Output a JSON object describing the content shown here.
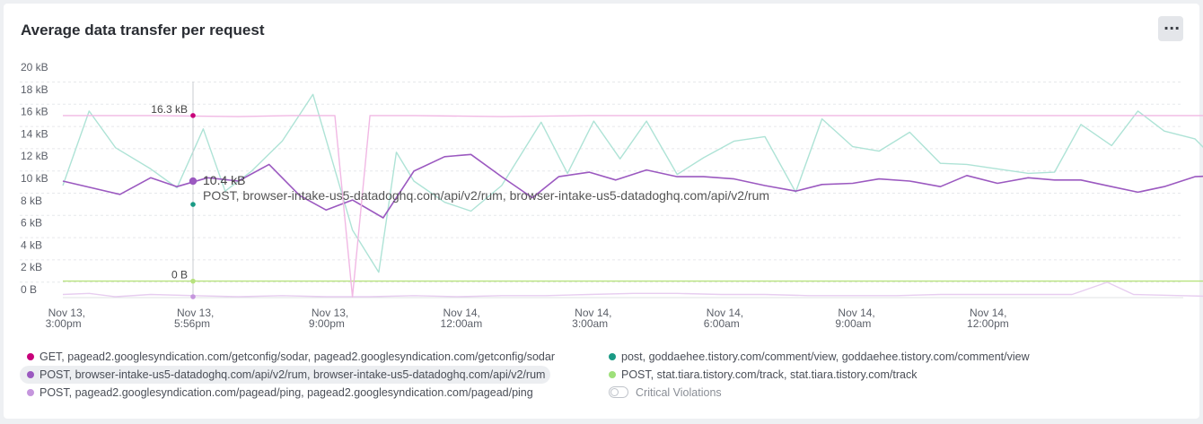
{
  "card": {
    "title": "Average data transfer per request",
    "menu_label": "···"
  },
  "chart_data": {
    "type": "line",
    "ylim": [
      0,
      20
    ],
    "yunit": "kB",
    "y_ticks": [
      "0 B",
      "2 kB",
      "4 kB",
      "6 kB",
      "8 kB",
      "10 kB",
      "12 kB",
      "14 kB",
      "16 kB",
      "18 kB",
      "20 kB"
    ],
    "x_range": [
      "Nov 13 14:58",
      "Nov 14 16:30"
    ],
    "x_ticks": [
      {
        "t": "Nov 13 15:00",
        "line1": "Nov 13,",
        "line2": "3:00pm"
      },
      {
        "t": "Nov 13 17:56",
        "line1": "Nov 13,",
        "line2": "5:56pm"
      },
      {
        "t": "Nov 13 21:00",
        "line1": "Nov 13,",
        "line2": "9:00pm"
      },
      {
        "t": "Nov 14 00:00",
        "line1": "Nov 14,",
        "line2": "12:00am"
      },
      {
        "t": "Nov 14 03:00",
        "line1": "Nov 14,",
        "line2": "3:00am"
      },
      {
        "t": "Nov 14 06:00",
        "line1": "Nov 14,",
        "line2": "6:00am"
      },
      {
        "t": "Nov 14 09:00",
        "line1": "Nov 14,",
        "line2": "9:00am"
      },
      {
        "t": "Nov 14 12:00",
        "line1": "Nov 14,",
        "line2": "12:00pm"
      }
    ],
    "grid": true,
    "series": [
      {
        "name": "GET, pagead2.googlesyndication.com/getconfig/sodar, pagead2.googlesyndication.com/getconfig/sodar",
        "color": "#f1b8e4",
        "values": [
          [
            0.0,
            16.3
          ],
          [
            2.0,
            16.3
          ],
          [
            4.0,
            16.2
          ],
          [
            5.2,
            16.3
          ],
          [
            6.2,
            16.3
          ],
          [
            6.6,
            0
          ],
          [
            7.0,
            16.3
          ],
          [
            8.0,
            16.3
          ],
          [
            10.0,
            16.2
          ],
          [
            12.0,
            16.3
          ],
          [
            16.0,
            16.3
          ],
          [
            20.0,
            16.3
          ],
          [
            24.0,
            16.3
          ],
          [
            26.0,
            16.3
          ]
        ]
      },
      {
        "name": "post, goddaehee.tistory.com/comment/view, goddaehee.tistory.com/comment/view",
        "color": "#aee3d6",
        "values": [
          [
            0.0,
            10.0
          ],
          [
            0.6,
            16.7
          ],
          [
            1.2,
            13.4
          ],
          [
            2.0,
            11.5
          ],
          [
            2.6,
            9.8
          ],
          [
            3.2,
            15.1
          ],
          [
            3.7,
            9.5
          ],
          [
            4.3,
            11.3
          ],
          [
            5.0,
            14.0
          ],
          [
            5.7,
            18.2
          ],
          [
            6.6,
            6.0
          ],
          [
            7.2,
            2.2
          ],
          [
            7.6,
            13.0
          ],
          [
            8.0,
            10.4
          ],
          [
            8.7,
            8.5
          ],
          [
            9.3,
            7.7
          ],
          [
            10.0,
            10.0
          ],
          [
            10.9,
            15.7
          ],
          [
            11.5,
            11.1
          ],
          [
            12.1,
            15.8
          ],
          [
            12.7,
            12.4
          ],
          [
            13.3,
            15.8
          ],
          [
            14.0,
            11.0
          ],
          [
            14.6,
            12.5
          ],
          [
            15.3,
            14.0
          ],
          [
            16.0,
            14.4
          ],
          [
            16.7,
            9.4
          ],
          [
            17.3,
            16.0
          ],
          [
            18.0,
            13.5
          ],
          [
            18.6,
            13.1
          ],
          [
            19.3,
            14.8
          ],
          [
            20.0,
            12.0
          ],
          [
            20.6,
            11.9
          ],
          [
            21.3,
            11.5
          ],
          [
            22.0,
            11.1
          ],
          [
            22.6,
            11.2
          ],
          [
            23.2,
            15.5
          ],
          [
            23.9,
            13.6
          ],
          [
            24.5,
            16.7
          ],
          [
            25.1,
            14.9
          ],
          [
            25.8,
            14.2
          ],
          [
            26.4,
            11.8
          ],
          [
            27.0,
            14.9
          ],
          [
            27.7,
            13.5
          ],
          [
            28.3,
            12.3
          ],
          [
            29.0,
            11.9
          ],
          [
            29.8,
            13.0
          ],
          [
            30.5,
            17.9
          ],
          [
            31.0,
            11.8
          ]
        ]
      },
      {
        "name": "POST, browser-intake-us5-datadoghq.com/api/v2/rum, browser-intake-us5-datadoghq.com/api/v2/rum",
        "color": "#9b59c0",
        "values": [
          [
            0.0,
            10.4
          ],
          [
            1.3,
            9.2
          ],
          [
            2.0,
            10.7
          ],
          [
            2.6,
            9.9
          ],
          [
            3.3,
            10.7
          ],
          [
            4.0,
            10.4
          ],
          [
            4.7,
            11.9
          ],
          [
            5.4,
            9.1
          ],
          [
            6.0,
            7.8
          ],
          [
            6.6,
            8.7
          ],
          [
            7.3,
            7.1
          ],
          [
            8.0,
            11.3
          ],
          [
            8.7,
            12.6
          ],
          [
            9.3,
            12.8
          ],
          [
            10.0,
            10.8
          ],
          [
            10.7,
            8.9
          ],
          [
            11.3,
            10.8
          ],
          [
            12.0,
            11.2
          ],
          [
            12.6,
            10.5
          ],
          [
            13.3,
            11.4
          ],
          [
            14.0,
            10.8
          ],
          [
            14.6,
            10.8
          ],
          [
            15.3,
            10.6
          ],
          [
            16.0,
            10.0
          ],
          [
            16.7,
            9.5
          ],
          [
            17.3,
            10.1
          ],
          [
            18.0,
            10.2
          ],
          [
            18.6,
            10.6
          ],
          [
            19.3,
            10.4
          ],
          [
            20.0,
            9.9
          ],
          [
            20.6,
            10.9
          ],
          [
            21.3,
            10.2
          ],
          [
            22.0,
            10.7
          ],
          [
            22.6,
            10.5
          ],
          [
            23.2,
            10.5
          ],
          [
            23.9,
            9.9
          ],
          [
            24.5,
            9.4
          ],
          [
            25.1,
            9.9
          ],
          [
            25.8,
            10.8
          ],
          [
            26.4,
            10.9
          ],
          [
            27.0,
            10.5
          ],
          [
            27.7,
            9.7
          ],
          [
            28.3,
            10.3
          ],
          [
            29.0,
            10.8
          ],
          [
            29.6,
            11.7
          ],
          [
            30.2,
            11.3
          ],
          [
            30.7,
            11.7
          ],
          [
            31.2,
            10.0
          ]
        ]
      },
      {
        "name": "POST, stat.tiara.tistory.com/track, stat.tiara.tistory.com/track",
        "color": "#b7e27e",
        "values": [
          [
            0.0,
            1.4
          ],
          [
            5.0,
            1.4
          ],
          [
            10.0,
            1.4
          ],
          [
            15.0,
            1.4
          ],
          [
            20.0,
            1.4
          ],
          [
            25.0,
            1.4
          ],
          [
            31.2,
            1.4
          ]
        ]
      },
      {
        "name": "POST, pagead2.googlesyndication.com/pagead/ping, pagead2.googlesyndication.com/pagead/ping",
        "color": "#e7cdf0",
        "values": [
          [
            0.0,
            0.2
          ],
          [
            0.6,
            0.3
          ],
          [
            1.2,
            0.0
          ],
          [
            2.0,
            0.2
          ],
          [
            3.0,
            0.1
          ],
          [
            4.0,
            0.0
          ],
          [
            5.0,
            0.1
          ],
          [
            6.0,
            0.0
          ],
          [
            7.0,
            0.0
          ],
          [
            8.0,
            0.1
          ],
          [
            9.0,
            0.0
          ],
          [
            10.0,
            0.1
          ],
          [
            11.0,
            0.1
          ],
          [
            12.0,
            0.2
          ],
          [
            13.0,
            0.3
          ],
          [
            14.0,
            0.3
          ],
          [
            15.0,
            0.2
          ],
          [
            16.0,
            0.2
          ],
          [
            17.0,
            0.1
          ],
          [
            18.0,
            0.1
          ],
          [
            19.0,
            0.1
          ],
          [
            20.0,
            0.2
          ],
          [
            21.0,
            0.2
          ],
          [
            22.0,
            0.2
          ],
          [
            23.0,
            0.2
          ],
          [
            23.8,
            1.3
          ],
          [
            24.4,
            0.2
          ],
          [
            25.5,
            0.1
          ],
          [
            26.5,
            0.0
          ],
          [
            27.5,
            0.2
          ],
          [
            28.5,
            0.2
          ],
          [
            29.5,
            0.3
          ],
          [
            30.5,
            0.3
          ],
          [
            31.2,
            0.3
          ]
        ]
      }
    ],
    "cursor": {
      "x": "Nov 13 17:56",
      "markers": [
        {
          "label": "16.3 kB",
          "value": 16.3,
          "color": "#c8007a"
        },
        {
          "label": "",
          "value": 10.4,
          "color": "#9b59c0"
        },
        {
          "label": "",
          "value": 8.3,
          "color": "#1a9a85"
        },
        {
          "label": "0 B",
          "value": 1.4,
          "color": "#b7e27e"
        },
        {
          "label": "",
          "value": 0.0,
          "color": "#c596dd"
        }
      ],
      "tooltip_value": "10.4 kB",
      "tooltip_series": "POST, browser-intake-us5-datadoghq.com/api/v2/rum, browser-intake-us5-datadoghq.com/api/v2/rum"
    }
  },
  "legend": {
    "items": [
      {
        "label": "GET, pagead2.googlesyndication.com/getconfig/sodar, pagead2.googlesyndication.com/getconfig/sodar",
        "color": "#c8007a"
      },
      {
        "label": "POST, browser-intake-us5-datadoghq.com/api/v2/rum, browser-intake-us5-datadoghq.com/api/v2/rum",
        "color": "#9b59c0"
      },
      {
        "label": "POST, pagead2.googlesyndication.com/pagead/ping, pagead2.googlesyndication.com/pagead/ping",
        "color": "#c596dd"
      },
      {
        "label": "post, goddaehee.tistory.com/comment/view, goddaehee.tistory.com/comment/view",
        "color": "#1a9a85"
      },
      {
        "label": "POST, stat.tiara.tistory.com/track, stat.tiara.tistory.com/track",
        "color": "#9ee07a"
      }
    ],
    "critical_violations_label": "Critical Violations"
  }
}
